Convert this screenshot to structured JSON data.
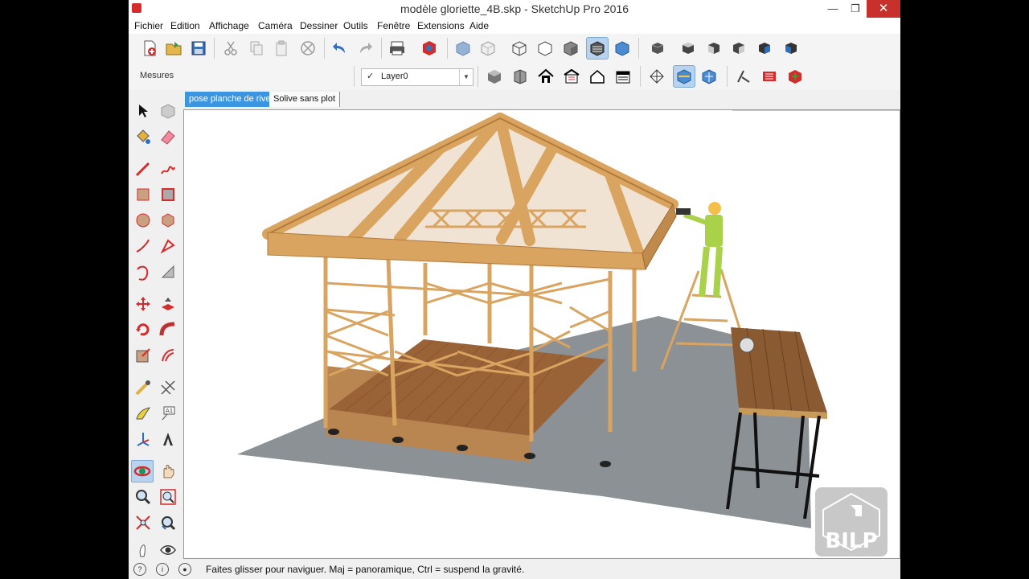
{
  "window": {
    "title": "modèle gloriette_4B.skp - SketchUp Pro 2016"
  },
  "menu": [
    "Fichier",
    "Edition",
    "Affichage",
    "Caméra",
    "Dessiner",
    "Outils",
    "Fenêtre",
    "Extensions",
    "Aide"
  ],
  "toolbar": {
    "measurements_label": "Mesures",
    "layer": {
      "check": "✓",
      "value": "Layer0"
    }
  },
  "scenes": {
    "tabs": [
      "pose planche de rive",
      "Solive sans plot"
    ],
    "active_index": 0
  },
  "status": {
    "message": "Faites glisser pour naviguer. Maj = panoramique, Ctrl =  suspend la gravité."
  },
  "watermark": {
    "text": "BILP"
  },
  "colors": {
    "accent": "#3c95e0",
    "wood": "#d8a460",
    "deck": "#8a5a32",
    "ground": "#8c9196",
    "close": "#c7302b"
  },
  "icons": {
    "main_toolbar": [
      "new-file-icon",
      "open-folder-icon",
      "save-icon",
      "cut-icon",
      "copy-icon",
      "paste-icon",
      "erase-icon",
      "undo-icon",
      "redo-icon",
      "print-icon",
      "model-info-icon",
      "xray-icon",
      "backface-icon",
      "wireframe-icon",
      "hidden-line-icon",
      "shaded-icon",
      "shaded-texture-icon",
      "monochrome-icon",
      "iso-view-icon",
      "top-view-icon",
      "front-view-icon",
      "right-view-icon",
      "back-view-icon",
      "left-view-icon"
    ],
    "second_toolbar": [
      "make-component-icon",
      "warehouse-box-icon",
      "house-icon",
      "warehouse-share-icon",
      "house-outline-icon",
      "garage-icon",
      "section-plane-icon",
      "display-sections-icon",
      "section-cuts-icon",
      "sandbox-icon",
      "hammer-icon",
      "extension-icon"
    ],
    "left_toolbar": [
      "select-icon",
      "component-icon",
      "paint-bucket-icon",
      "eraser-icon",
      "pencil-line-icon",
      "freehand-icon",
      "rectangle-icon",
      "rotated-rectangle-icon",
      "circle-icon",
      "polygon-icon",
      "arc-icon",
      "pie-icon",
      "arc-3pt-icon",
      "arc-2pt-icon",
      "move-icon",
      "push-pull-icon",
      "rotate-icon",
      "follow-me-icon",
      "scale-icon",
      "offset-icon",
      "tape-measure-icon",
      "dimension-icon",
      "protractor-icon",
      "text-icon",
      "axes-icon",
      "3d-text-icon",
      "orbit-icon",
      "pan-icon",
      "zoom-icon",
      "zoom-window-icon",
      "zoom-extents-icon",
      "previous-view-icon",
      "walk-icon",
      "look-around-icon"
    ]
  }
}
